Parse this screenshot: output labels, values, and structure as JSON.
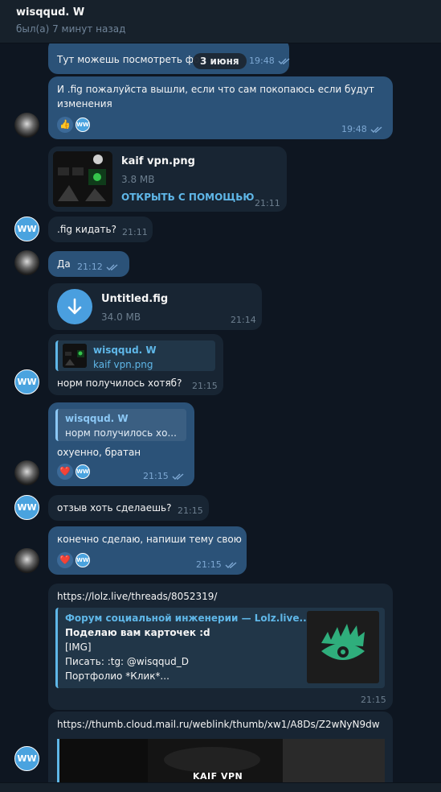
{
  "header": {
    "title": "wisqqud. W",
    "status": "был(а) 7 минут назад"
  },
  "date_pill": "3 июня",
  "avatar_initials": "WW",
  "messages": [
    {
      "text": "Тут можешь посмотреть фо",
      "time": "19:48"
    },
    {
      "text_line1": "И .fig пожалуйста вышли, если что сам покопаюсь если будут",
      "text_line2": "изменения",
      "time": "19:48",
      "reaction": "👍"
    },
    {
      "file_name": "kaif vpn.png",
      "file_size": "3.8 MB",
      "file_action": "ОТКРЫТЬ С ПОМОЩЬЮ",
      "time": "21:11"
    },
    {
      "text": ".fig кидать?",
      "time": "21:11"
    },
    {
      "text": "Да",
      "time": "21:12"
    },
    {
      "file_name": "Untitled.fig",
      "file_size": "34.0 MB",
      "time": "21:14"
    },
    {
      "quote_name": "wisqqud. W",
      "quote_text": "kaif vpn.png",
      "text": "норм получилось хотяб?",
      "time": "21:15"
    },
    {
      "quote_name": "wisqqud. W",
      "quote_text": "норм получилось хо...",
      "text": "охуенно, братан",
      "time": "21:15",
      "reaction": "❤️"
    },
    {
      "text": "отзыв хоть сделаешь?",
      "time": "21:15"
    },
    {
      "text": "конечно сделаю, напиши тему свою",
      "time": "21:15",
      "reaction": "❤️"
    },
    {
      "link": "https://lolz.live/threads/8052319/",
      "preview_title": "Форум социальной инженерии — Lolz.live...",
      "preview_line1": "Поделаю вам карточек :d",
      "preview_line2": "[IMG]",
      "preview_line3": "Писать: :tg: @wisqqud_D",
      "preview_line4": "Портфолио *Клик*...",
      "time": "21:15"
    },
    {
      "link": "https://thumb.cloud.mail.ru/weblink/thumb/xw1/A8Ds/Z2wNyN9dw",
      "image_caption": "KAIF VPN"
    }
  ],
  "colors": {
    "background": "#0e1621",
    "incoming": "#182533",
    "outgoing": "#2b5278",
    "accent": "#5fb7e8",
    "preview_logo": "#2fae7c"
  }
}
